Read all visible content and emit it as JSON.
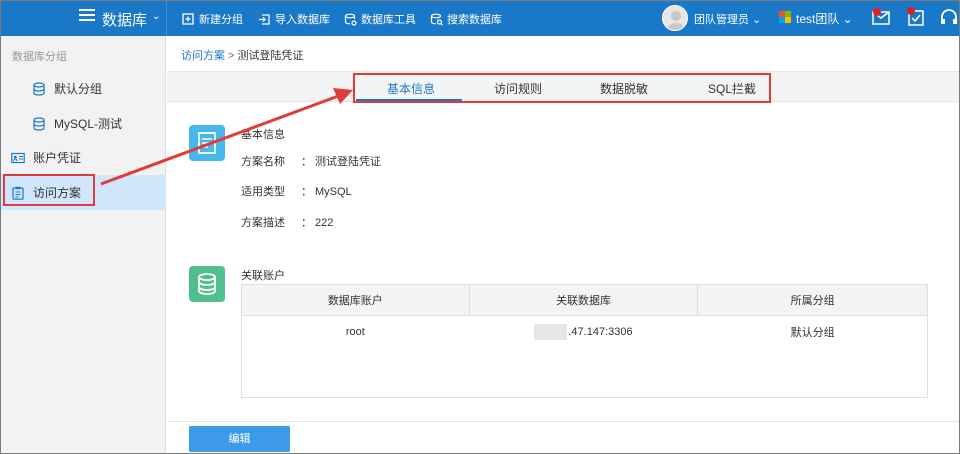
{
  "topbar": {
    "title": "数据库",
    "actions": [
      {
        "label": "新建分组",
        "icon": "new-group-icon"
      },
      {
        "label": "导入数据库",
        "icon": "import-icon"
      },
      {
        "label": "数据库工具",
        "icon": "db-tool-icon"
      },
      {
        "label": "搜索数据库",
        "icon": "search-db-icon"
      }
    ],
    "user": "团队管理员",
    "team": "test团队",
    "brand_color": "#1a78c8"
  },
  "sidebar": {
    "header": "数据库分组",
    "items": [
      {
        "label": "默认分组",
        "icon": "database-icon"
      },
      {
        "label": "MySQL-测试",
        "icon": "database-icon"
      },
      {
        "label": "账户凭证",
        "icon": "id-card-icon"
      },
      {
        "label": "访问方案",
        "icon": "clipboard-icon",
        "active": true
      }
    ]
  },
  "breadcrumb": {
    "parent": "访问方案",
    "separator": ">",
    "current": "测试登陆凭证"
  },
  "tabs": [
    {
      "label": "基本信息",
      "active": true
    },
    {
      "label": "访问规则"
    },
    {
      "label": "数据脱敏"
    },
    {
      "label": "SQL拦截"
    }
  ],
  "basic_info": {
    "title": "基本信息",
    "rows": [
      {
        "key": "方案名称",
        "colon": "：",
        "value": "测试登陆凭证"
      },
      {
        "key": "适用类型",
        "colon": "：",
        "value": "MySQL"
      },
      {
        "key": "方案描述",
        "colon": "：",
        "value": "222"
      }
    ]
  },
  "linked_accounts": {
    "title": "关联账户",
    "columns": [
      "数据库账户",
      "关联数据库",
      "所属分组"
    ],
    "rows": [
      {
        "account": "root",
        "database": ".47.147:3306",
        "group": "默认分组"
      }
    ]
  },
  "edit_button": "编辑",
  "colors": {
    "accent": "#1a78c8",
    "highlight_red": "#e03c3c",
    "info_icon": "#47b7ef",
    "accounts_icon": "#4fc08d"
  }
}
